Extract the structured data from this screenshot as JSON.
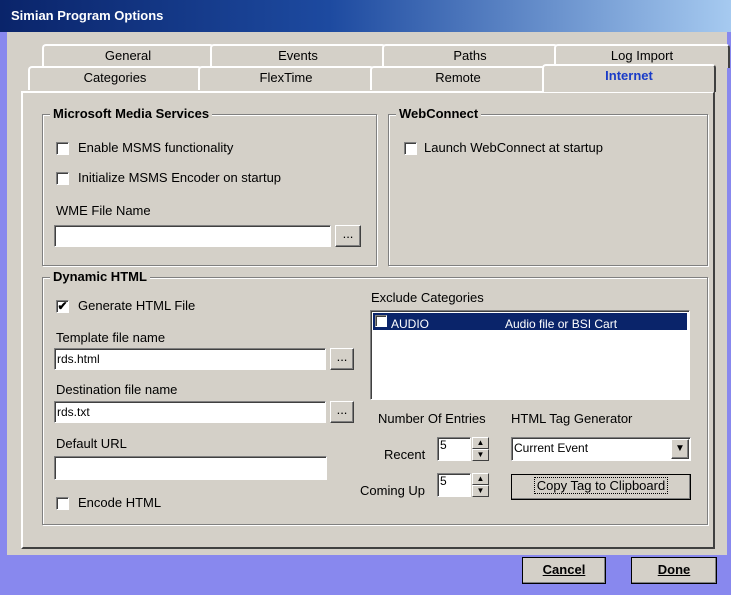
{
  "window": {
    "title": "Simian Program Options"
  },
  "tabs": {
    "row1": [
      "General",
      "Events",
      "Paths",
      "Log Import"
    ],
    "row2": [
      "Categories",
      "FlexTime",
      "Remote",
      "Internet"
    ]
  },
  "msms": {
    "title": "Microsoft Media Services",
    "enable_label": "Enable MSMS functionality",
    "enable_checked": false,
    "init_label": "Initialize MSMS Encoder on startup",
    "init_checked": false,
    "wme_label": "WME File Name",
    "wme_value": "",
    "browse_label": "..."
  },
  "webconnect": {
    "title": "WebConnect",
    "launch_label": "Launch WebConnect at startup",
    "launch_checked": false
  },
  "dhtml": {
    "title": "Dynamic HTML",
    "generate_label": "Generate HTML File",
    "generate_checked": true,
    "generate_mark": "✔",
    "template_label": "Template file name",
    "template_value": "rds.html",
    "dest_label": "Destination file name",
    "dest_value": "rds.txt",
    "url_label": "Default URL",
    "url_value": "",
    "encode_label": "Encode HTML",
    "encode_checked": false,
    "browse_label": "...",
    "exclude_label": "Exclude Categories",
    "exclude_items": [
      {
        "name": "AUDIO",
        "desc": "Audio file or BSI Cart",
        "checked": false
      }
    ],
    "entries_label": "Number Of Entries",
    "recent_label": "Recent",
    "recent_value": "5",
    "comingup_label": "Coming Up",
    "comingup_value": "5",
    "tag_gen_label": "HTML Tag Generator",
    "tag_gen_value": "Current Event",
    "copy_button": "Copy Tag to Clipboard"
  },
  "footer": {
    "cancel_label": "Cancel",
    "done_label": "Done"
  },
  "icons": {
    "dropdown": "chevron-down-icon",
    "spin_up": "spin-up-icon",
    "spin_down": "spin-down-icon"
  }
}
